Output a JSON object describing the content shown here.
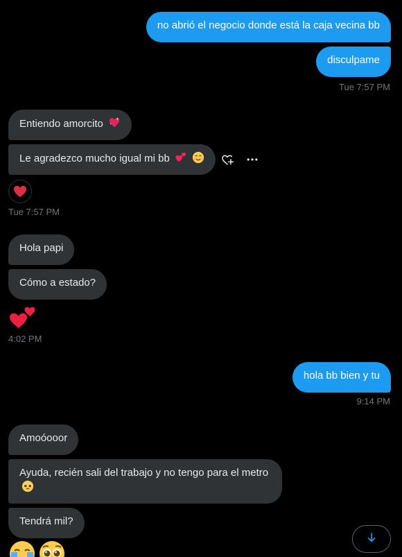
{
  "messages": {
    "m1": "no abrió el negocio donde está la caja vecina bb",
    "m2": "disculpame",
    "ts1": "Tue 7:57 PM",
    "m3": "Entiendo amorcito",
    "m4": "Le agradezco mucho igual mi bb",
    "ts2": "Tue 7:57 PM",
    "m5": "Hola papi",
    "m6": "Cómo a estado?",
    "ts3": "4:02 PM",
    "m7": "hola bb bien y tu",
    "ts4": "9:14 PM",
    "m8": "Amoóooor",
    "m9": "Ayuda, recién sali del trabajo y no tengo para el metro",
    "m10": "Tendrá mil?"
  },
  "emojis": {
    "sparkling_heart": "sparkling-heart",
    "two_hearts": "two-hearts",
    "smiling_blush": "smiling-face",
    "red_heart_reaction": "red-heart",
    "pleading": "pleading-face",
    "crying": "loudly-crying-face"
  },
  "icons": {
    "add_reaction": "add-reaction-icon",
    "more": "more-icon",
    "scroll_down": "arrow-down-icon"
  },
  "colors": {
    "background": "#000000",
    "sent_bubble": "#1d9bf0",
    "received_bubble": "#2f3336",
    "timestamp": "#71767b",
    "heart": "#f91880"
  }
}
